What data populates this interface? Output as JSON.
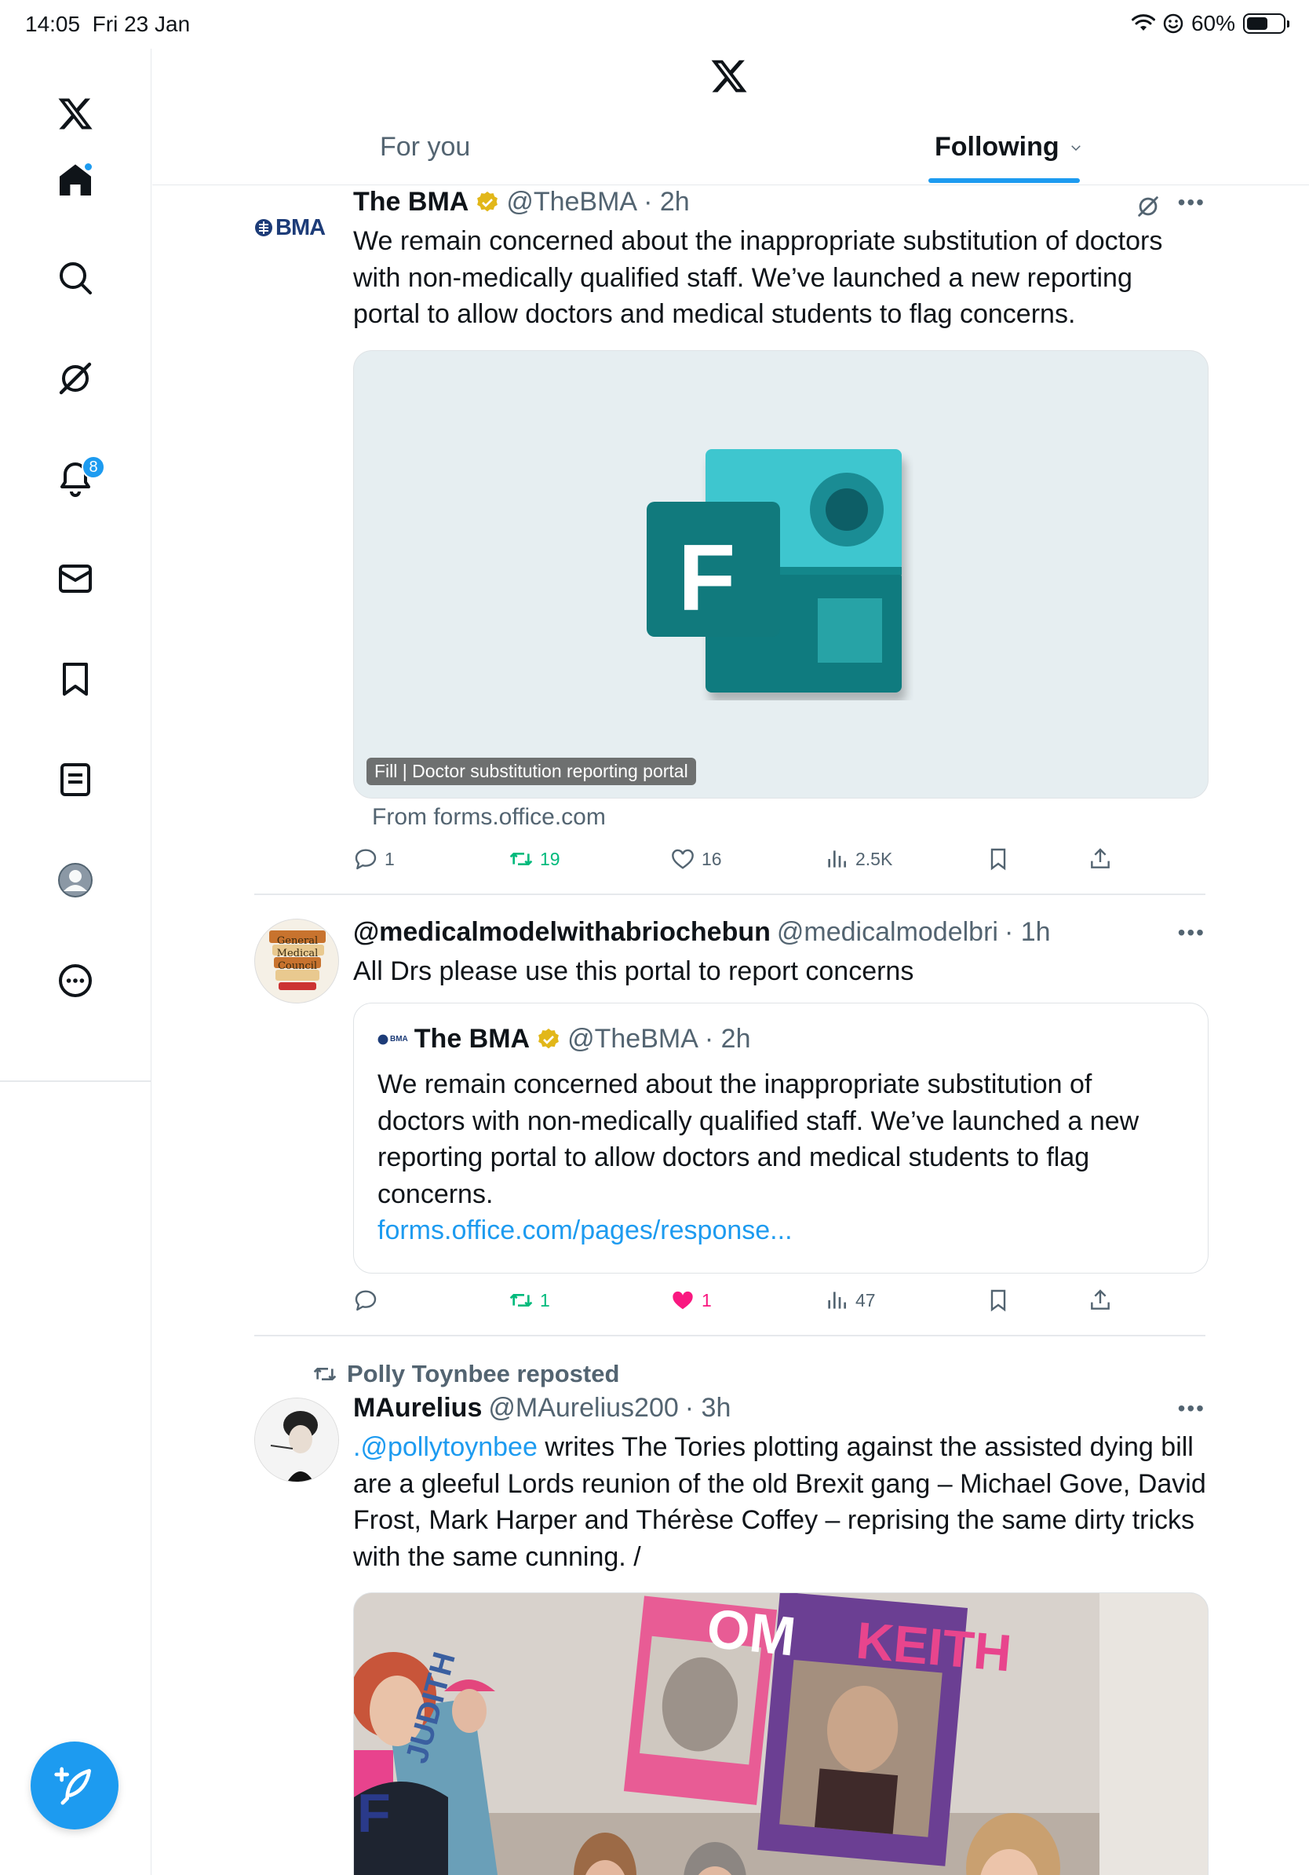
{
  "status_bar": {
    "time": "14:05",
    "date": "Fri 23 Jan",
    "battery": "60%"
  },
  "sidebar": {
    "items": [
      {
        "name": "home",
        "icon": "home-icon",
        "active": true
      },
      {
        "name": "search",
        "icon": "search-icon"
      },
      {
        "name": "grok",
        "icon": "grok-icon"
      },
      {
        "name": "notifications",
        "icon": "bell-icon",
        "badge": "8"
      },
      {
        "name": "messages",
        "icon": "mail-icon"
      },
      {
        "name": "bookmarks",
        "icon": "bookmark-icon"
      },
      {
        "name": "lists",
        "icon": "list-icon"
      },
      {
        "name": "profile",
        "icon": "profile-icon"
      },
      {
        "name": "more",
        "icon": "more-icon"
      }
    ],
    "compose_icon": "compose-icon"
  },
  "header": {
    "tabs": [
      {
        "label": "For you"
      },
      {
        "label": "Following"
      }
    ]
  },
  "tweets": [
    {
      "avatar_text": "BMA",
      "name": "The BMA",
      "handle": "@TheBMA",
      "time": "· 2h",
      "text_lines": [
        "We remain concerned about the inappropriate substitution of doctors",
        "with non-medically qualified staff. We’ve launched a new reporting",
        "portal to allow doctors and medical students to flag concerns."
      ],
      "card": {
        "label": "Fill | Doctor substitution reporting portal",
        "from": "From forms.office.com",
        "icon_letter": "F"
      },
      "stats": {
        "replies": "1",
        "reposts": "19",
        "likes": "16",
        "views": "2.5K"
      }
    },
    {
      "avatar_text": "General Medical Council",
      "name": "@medicalmodelwithabriochebun",
      "handle": "@medicalmodelbri",
      "time": "· 1h",
      "text_lines": [
        "All Drs please use this portal to report concerns"
      ],
      "quote": {
        "avatar_text": "BMA",
        "name": "The BMA",
        "handle": "@TheBMA",
        "time": "· 2h",
        "text_lines": [
          "We remain concerned about the inappropriate substitution of",
          "doctors with non-medically qualified staff. We’ve launched a new",
          "reporting portal to allow doctors and medical students to flag",
          "concerns."
        ],
        "link": "forms.office.com/pages/response..."
      },
      "stats": {
        "replies": "",
        "reposts": "1",
        "likes": "1",
        "views": "47"
      }
    },
    {
      "repost_by": "Polly Toynbee reposted",
      "name": "MAurelius",
      "handle": "@MAurelius200",
      "time": "· 3h",
      "mention": ".@pollytoynbee",
      "text_first": " writes The Tories plotting against the assisted dying bill",
      "text_lines": [
        "are a gleeful Lords reunion of the old Brexit gang – Michael Gove, David",
        "Frost, Mark Harper and Thérèse Coffey – reprising the same dirty tricks",
        "with the same cunning. /"
      ],
      "image_sign_texts": [
        "OM",
        "KEITH",
        "JUDITH",
        "F"
      ]
    }
  ],
  "colors": {
    "accent": "#1d9bf0",
    "repost_green": "#00ba7c",
    "like_pink": "#f91880",
    "secondary_text": "#536471"
  }
}
